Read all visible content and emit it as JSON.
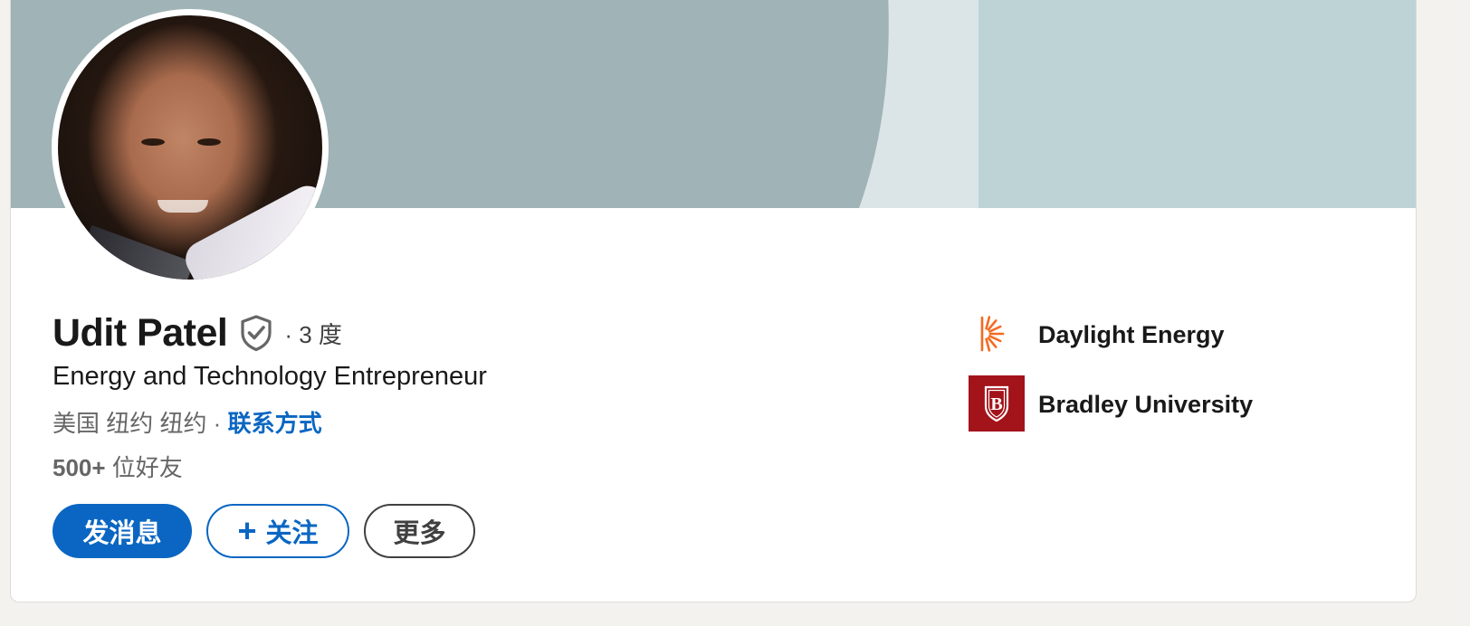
{
  "profile": {
    "name": "Udit Patel",
    "verified_icon": "shield-check-icon",
    "degree": "· 3 度",
    "headline": "Energy and Technology Entrepreneur",
    "location": "美国 纽约 纽约",
    "location_separator": " · ",
    "contact_info_label": "联系方式",
    "connections_count": "500+",
    "connections_label": " 位好友"
  },
  "actions": {
    "message_label": "发消息",
    "follow_icon": "+",
    "follow_label": "关注",
    "more_label": "更多"
  },
  "experience": [
    {
      "name": "Daylight Energy",
      "logo": "sunburst-logo"
    },
    {
      "name": "Bradley University",
      "logo": "bradley-logo",
      "logo_letter": "B"
    }
  ],
  "colors": {
    "accent": "#0a66c2",
    "banner_primary": "#a0b3b7",
    "banner_light": "#dbe5e7",
    "banner_secondary": "#bdd3d6",
    "daylight_orange": "#f36a21",
    "bradley_red": "#a3131a"
  }
}
